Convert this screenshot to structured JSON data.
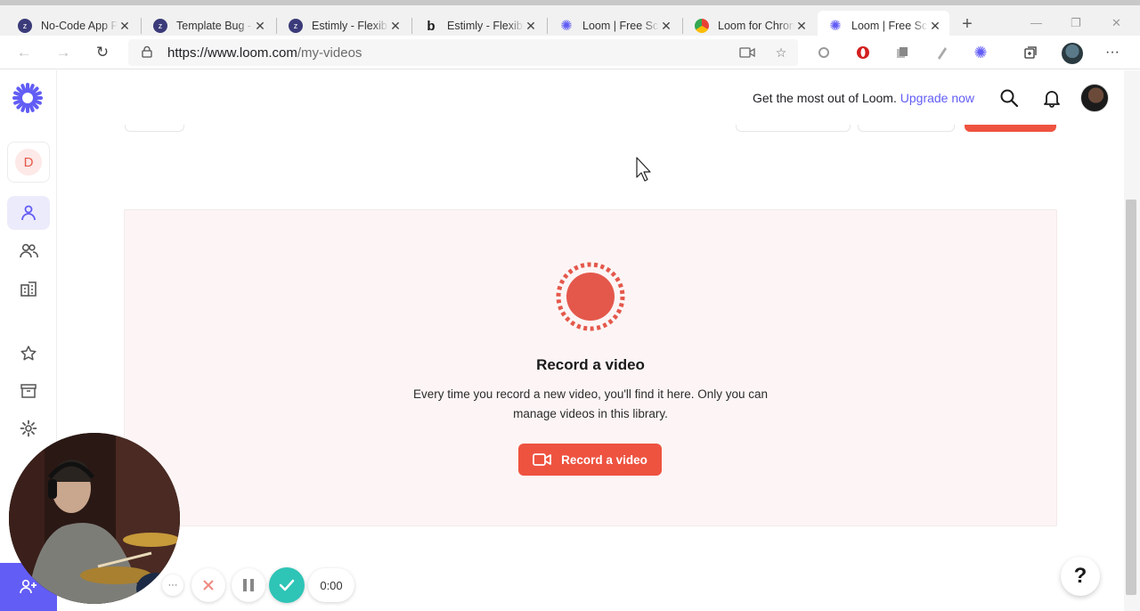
{
  "browser": {
    "tabs": [
      {
        "title": "No-Code App P",
        "favicon": "bubble-z-icon",
        "color": "#3b3b7a"
      },
      {
        "title": "Template Bug -",
        "favicon": "bubble-z-icon",
        "color": "#3b3b7a"
      },
      {
        "title": "Estimly - Flexibl",
        "favicon": "bubble-z-icon",
        "color": "#3b3b7a"
      },
      {
        "title": "Estimly - Flexibl",
        "favicon": "bubble-b-icon",
        "color": "#1a1a1a"
      },
      {
        "title": "Loom | Free Scr",
        "favicon": "loom-icon",
        "color": "#625df5"
      },
      {
        "title": "Loom for Chron",
        "favicon": "chrome-store-icon",
        "color": "#e0a030"
      },
      {
        "title": "Loom | Free Scr",
        "favicon": "loom-icon",
        "color": "#625df5"
      }
    ],
    "url_host": "https://www.loom.com",
    "url_path": "/my-videos"
  },
  "header": {
    "promo_text": "Get the most out of Loom.",
    "upgrade_link": "Upgrade now"
  },
  "sidebar": {
    "workspace_initial": "D",
    "items": [
      {
        "name": "my-library",
        "icon": "person-icon",
        "active": true
      },
      {
        "name": "team",
        "icon": "people-icon",
        "active": false
      },
      {
        "name": "workspace",
        "icon": "buildings-icon",
        "active": false
      },
      {
        "name": "favorites",
        "icon": "star-icon",
        "active": false
      },
      {
        "name": "archive",
        "icon": "archive-icon",
        "active": false
      },
      {
        "name": "settings",
        "icon": "gear-icon",
        "active": false
      }
    ]
  },
  "empty_state": {
    "title": "Record a video",
    "description": "Every time you record a new video, you'll find it here. Only you can manage videos in this library.",
    "button_label": "Record a video"
  },
  "recorder": {
    "timer": "0:00",
    "more": "···"
  },
  "help": "?",
  "colors": {
    "brand": "#625df5",
    "record": "#ee5340",
    "card_bg": "#fdf5f5",
    "confirm": "#2ec4b6"
  }
}
